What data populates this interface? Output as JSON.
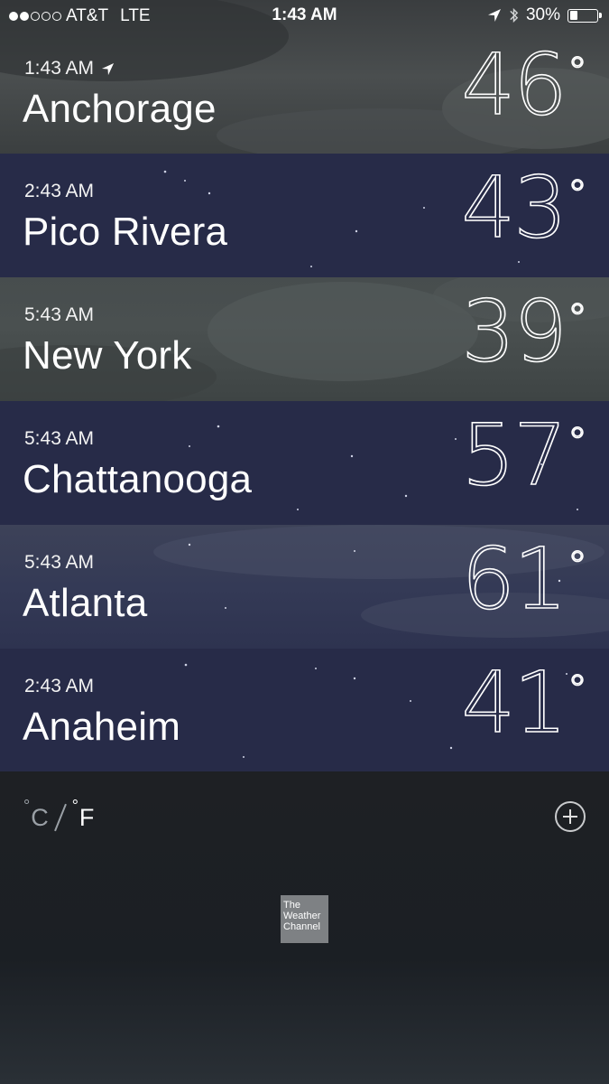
{
  "status_bar": {
    "signal_filled": 2,
    "signal_total": 5,
    "carrier": "AT&T",
    "network": "LTE",
    "time": "1:43 AM",
    "battery_text": "30%",
    "battery_level": 0.3,
    "icons": [
      "location-arrow-icon",
      "bluetooth-icon",
      "battery-icon"
    ]
  },
  "cities": [
    {
      "time": "1:43 AM",
      "name": "Anchorage",
      "temp": "46",
      "current_location": true
    },
    {
      "time": "2:43 AM",
      "name": "Pico Rivera",
      "temp": "43",
      "current_location": false
    },
    {
      "time": "5:43 AM",
      "name": "New York",
      "temp": "39",
      "current_location": false
    },
    {
      "time": "5:43 AM",
      "name": "Chattanooga",
      "temp": "57",
      "current_location": false
    },
    {
      "time": "5:43 AM",
      "name": "Atlanta",
      "temp": "61",
      "current_location": false
    },
    {
      "time": "2:43 AM",
      "name": "Anaheim",
      "temp": "41",
      "current_location": false
    }
  ],
  "degree_symbol": "°",
  "units": {
    "celsius": "C",
    "fahrenheit": "F",
    "degree": "°",
    "selected": "F"
  },
  "logo": {
    "line1": "The",
    "line2": "Weather",
    "line3": "Channel"
  },
  "colors": {
    "night_row": "#272b48",
    "cloudy_row": "#474d4e",
    "logo_bg": "#7e8184"
  }
}
